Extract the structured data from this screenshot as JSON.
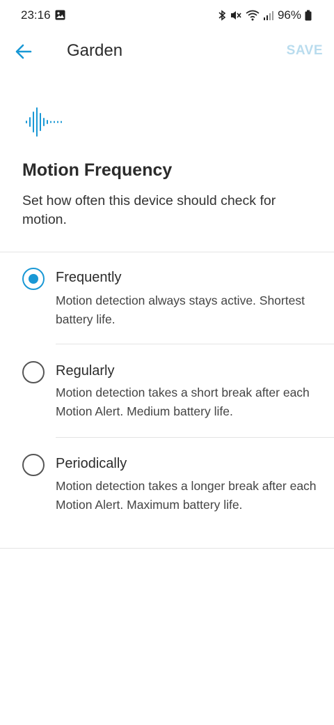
{
  "status_bar": {
    "time": "23:16",
    "battery": "96%",
    "icons": [
      "image-icon",
      "bluetooth-icon",
      "mute-icon",
      "wifi-icon",
      "signal-icon",
      "battery-icon"
    ]
  },
  "app_bar": {
    "title": "Garden",
    "save_label": "SAVE",
    "back_icon": "arrow-left-icon"
  },
  "header": {
    "icon": "sound-wave-icon",
    "title": "Motion Frequency",
    "description": "Set how often this device should check for motion."
  },
  "options": [
    {
      "title": "Frequently",
      "description": "Motion detection always stays active. Shortest battery life.",
      "selected": true
    },
    {
      "title": "Regularly",
      "description": "Motion detection takes a short break after each Motion Alert. Medium battery life.",
      "selected": false
    },
    {
      "title": "Periodically",
      "description": "Motion detection takes a longer break after each Motion Alert. Maximum battery life.",
      "selected": false
    }
  ],
  "colors": {
    "accent": "#1998d5",
    "save_disabled": "#b9dcee",
    "text": "#2b2b2b"
  }
}
